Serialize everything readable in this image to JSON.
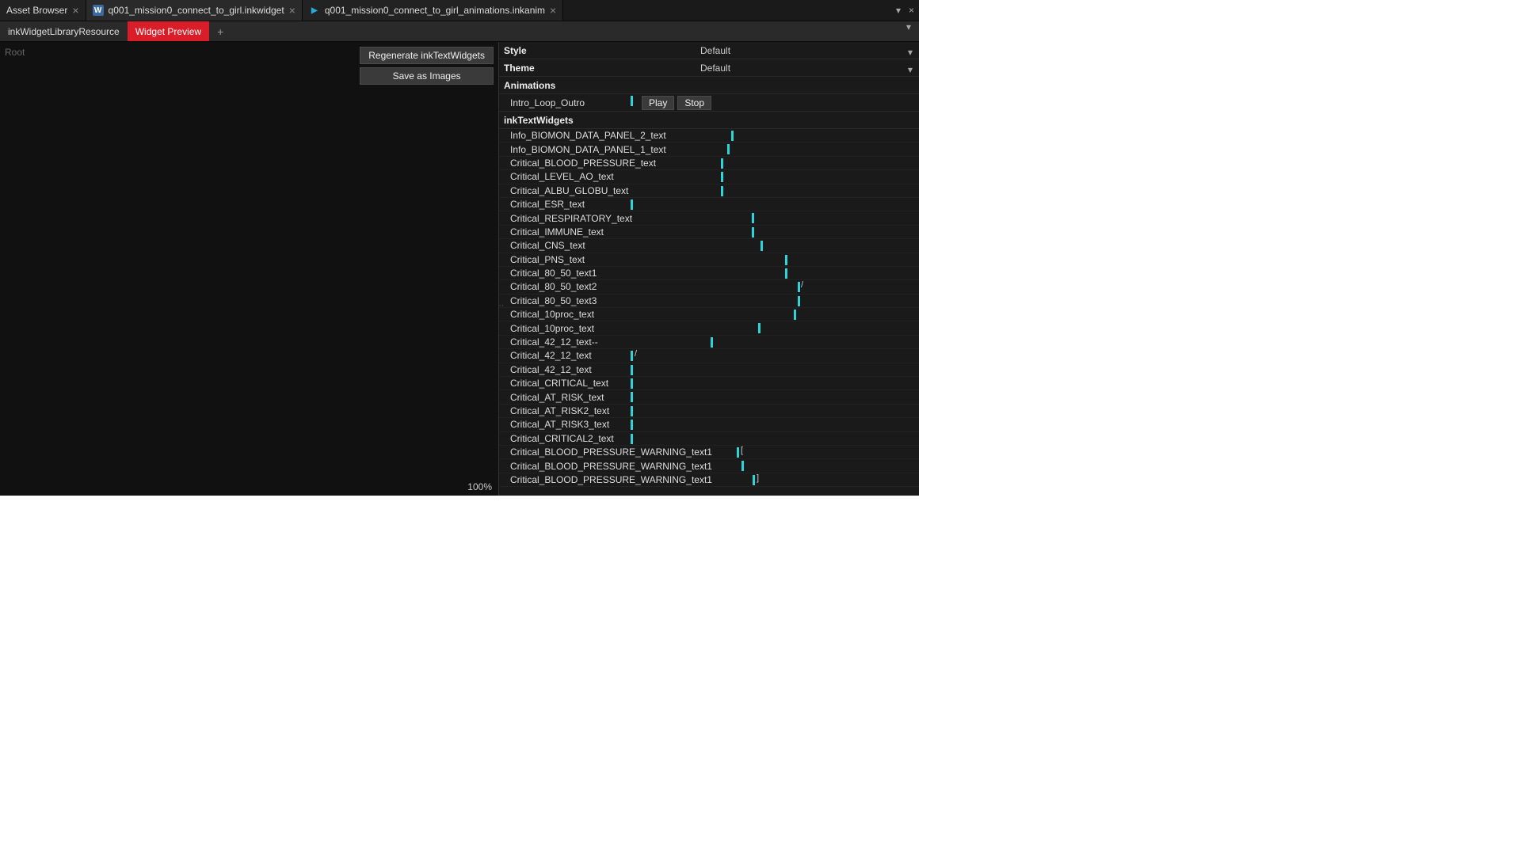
{
  "tabs": [
    {
      "label": "Asset Browser",
      "icon": "none"
    },
    {
      "label": "q001_mission0_connect_to_girl.inkwidget",
      "icon": "blue",
      "iconChar": "W"
    },
    {
      "label": "q001_mission0_connect_to_girl_animations.inkanim",
      "icon": "play"
    }
  ],
  "subtabs": {
    "first": "inkWidgetLibraryResource",
    "second": "Widget Preview"
  },
  "leftPane": {
    "root": "Root",
    "regen": "Regenerate inkTextWidgets",
    "saveImages": "Save as Images",
    "zoom": "100%"
  },
  "props": {
    "styleLabel": "Style",
    "styleValue": "Default",
    "themeLabel": "Theme",
    "themeValue": "Default"
  },
  "sections": {
    "animations": "Animations",
    "inkTextWidgets": "inkTextWidgets"
  },
  "animations": [
    {
      "name": "Intro_Loop_Outro",
      "play": "Play",
      "stop": "Stop"
    }
  ],
  "widgets": [
    {
      "name": "Info_BIOMON_DATA_PANEL_2_text",
      "tickPx": 293,
      "trail": ""
    },
    {
      "name": "Info_BIOMON_DATA_PANEL_1_text",
      "tickPx": 288,
      "trail": ""
    },
    {
      "name": "Critical_BLOOD_PRESSURE_text",
      "tickPx": 280,
      "trail": ""
    },
    {
      "name": "Critical_LEVEL_AO_text",
      "tickPx": 280,
      "trail": ""
    },
    {
      "name": "Critical_ALBU_GLOBU_text",
      "tickPx": 280,
      "trail": ""
    },
    {
      "name": "Critical_ESR_text",
      "tickPx": 166,
      "trail": ""
    },
    {
      "name": "Critical_RESPIRATORY_text",
      "tickPx": 319,
      "trail": ""
    },
    {
      "name": "Critical_IMMUNE_text",
      "tickPx": 319,
      "trail": ""
    },
    {
      "name": "Critical_CNS_text",
      "tickPx": 330,
      "trail": ""
    },
    {
      "name": "Critical_PNS_text",
      "tickPx": 361,
      "trail": ""
    },
    {
      "name": "Critical_80_50_text1",
      "tickPx": 361,
      "trail": ""
    },
    {
      "name": "Critical_80_50_text2",
      "tickPx": 377,
      "trail": "/",
      "trailPx": 381
    },
    {
      "name": "Critical_80_50_text3",
      "tickPx": 377,
      "trail": ""
    },
    {
      "name": "Critical_10proc_text",
      "tickPx": 372,
      "trail": ""
    },
    {
      "name": "Critical_10proc_text",
      "tickPx": 327,
      "trail": ""
    },
    {
      "name": "Critical_42_12_text--",
      "tickPx": 267,
      "trail": ""
    },
    {
      "name": "Critical_42_12_text",
      "tickPx": 166,
      "trail": "/",
      "trailPx": 171
    },
    {
      "name": "Critical_42_12_text",
      "tickPx": 166,
      "trail": ""
    },
    {
      "name": "Critical_CRITICAL_text",
      "tickPx": 166,
      "trail": ""
    },
    {
      "name": "Critical_AT_RISK_text",
      "tickPx": 166,
      "trail": ""
    },
    {
      "name": "Critical_AT_RISK2_text",
      "tickPx": 166,
      "trail": ""
    },
    {
      "name": "Critical_AT_RISK3_text",
      "tickPx": 166,
      "trail": ""
    },
    {
      "name": "Critical_CRITICAL2_text",
      "tickPx": 166,
      "trail": ""
    },
    {
      "name": "Critical_BLOOD_PRESSURE_WARNING_text1",
      "tickPx": 300,
      "trail": "[",
      "trailPx": 305
    },
    {
      "name": "Critical_BLOOD_PRESSURE_WARNING_text1",
      "tickPx": 306,
      "trail": ""
    },
    {
      "name": "Critical_BLOOD_PRESSURE_WARNING_text1",
      "tickPx": 320,
      "trail": "]",
      "trailPx": 325
    }
  ]
}
